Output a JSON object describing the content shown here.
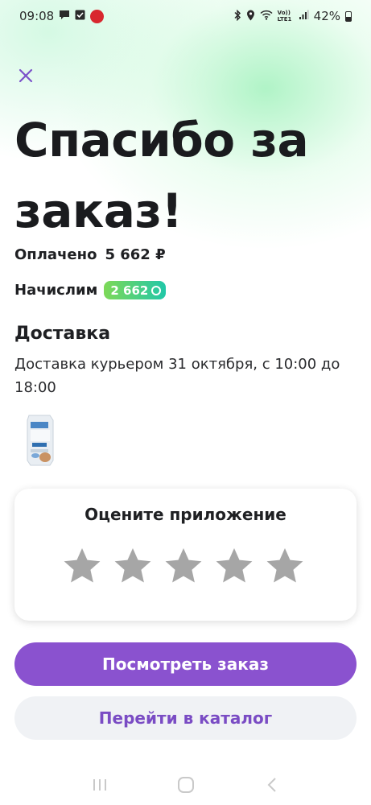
{
  "status_bar": {
    "time": "09:08",
    "battery": "42%",
    "icons_left": [
      "chat-icon",
      "check-box-icon",
      "app-notification-icon"
    ],
    "icons_right": [
      "bluetooth-icon",
      "location-icon",
      "wifi-icon",
      "volte-icon",
      "signal-icon",
      "battery-icon"
    ],
    "volte_label": "Vo)) LTE1"
  },
  "header": {
    "close_icon": "close-icon",
    "title": "Спасибо за заказ!"
  },
  "summary": {
    "paid_label": "Оплачено",
    "paid_amount": "5 662 ₽",
    "accrue_label": "Начислим",
    "bonus_amount": "2 662",
    "bonus_colors": [
      "#7ed957",
      "#21c7a8"
    ]
  },
  "delivery": {
    "title": "Доставка",
    "text": "Доставка курьером 31 октября, с 10:00 до 18:00"
  },
  "rating": {
    "title": "Оцените приложение",
    "stars": 5,
    "star_color": "#a6a6a6"
  },
  "actions": {
    "view_order": "Посмотреть заказ",
    "go_catalog": "Перейти в каталог",
    "accent": "#8a52cf"
  },
  "nav": {
    "recents_icon": "recents-icon",
    "home_icon": "home-icon",
    "back_icon": "back-icon"
  }
}
